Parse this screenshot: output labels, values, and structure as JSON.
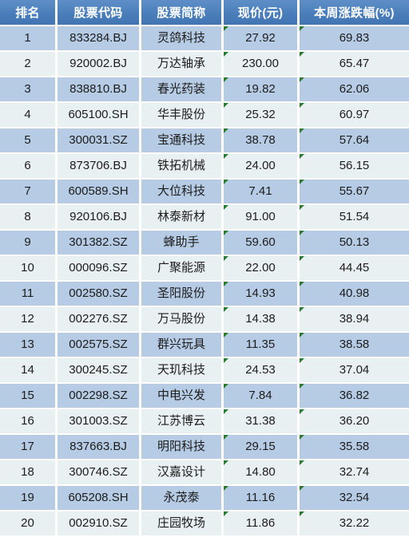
{
  "table": {
    "name": "stock-weekly-gainers-table",
    "columns": [
      {
        "key": "rank",
        "label": "排名",
        "marker": false
      },
      {
        "key": "code",
        "label": "股票代码",
        "marker": false
      },
      {
        "key": "name",
        "label": "股票简称",
        "marker": false
      },
      {
        "key": "price",
        "label": "现价(元)",
        "marker": true
      },
      {
        "key": "change",
        "label": "本周涨跌幅(%)",
        "marker": true
      }
    ],
    "marker_icon": "green-corner-triangle-icon",
    "marker_color": "#2d7a33",
    "header_color": "#4a7ebb",
    "row_odd_color": "#b6cbe4",
    "row_even_color": "#e9f0f2",
    "rows": [
      {
        "rank": "1",
        "code": "833284.BJ",
        "name": "灵鸽科技",
        "price": "27.92",
        "change": "69.83"
      },
      {
        "rank": "2",
        "code": "920002.BJ",
        "name": "万达轴承",
        "price": "230.00",
        "change": "65.47"
      },
      {
        "rank": "3",
        "code": "838810.BJ",
        "name": "春光药装",
        "price": "19.82",
        "change": "62.06"
      },
      {
        "rank": "4",
        "code": "605100.SH",
        "name": "华丰股份",
        "price": "25.32",
        "change": "60.97"
      },
      {
        "rank": "5",
        "code": "300031.SZ",
        "name": "宝通科技",
        "price": "38.78",
        "change": "57.64"
      },
      {
        "rank": "6",
        "code": "873706.BJ",
        "name": "铁拓机械",
        "price": "24.00",
        "change": "56.15"
      },
      {
        "rank": "7",
        "code": "600589.SH",
        "name": "大位科技",
        "price": "7.41",
        "change": "55.67"
      },
      {
        "rank": "8",
        "code": "920106.BJ",
        "name": "林泰新材",
        "price": "91.00",
        "change": "51.54"
      },
      {
        "rank": "9",
        "code": "301382.SZ",
        "name": "蜂助手",
        "price": "59.60",
        "change": "50.13"
      },
      {
        "rank": "10",
        "code": "000096.SZ",
        "name": "广聚能源",
        "price": "22.00",
        "change": "44.45"
      },
      {
        "rank": "11",
        "code": "002580.SZ",
        "name": "圣阳股份",
        "price": "14.93",
        "change": "40.98"
      },
      {
        "rank": "12",
        "code": "002276.SZ",
        "name": "万马股份",
        "price": "14.38",
        "change": "38.94"
      },
      {
        "rank": "13",
        "code": "002575.SZ",
        "name": "群兴玩具",
        "price": "11.35",
        "change": "38.58"
      },
      {
        "rank": "14",
        "code": "300245.SZ",
        "name": "天玑科技",
        "price": "24.53",
        "change": "37.04"
      },
      {
        "rank": "15",
        "code": "002298.SZ",
        "name": "中电兴发",
        "price": "7.84",
        "change": "36.82"
      },
      {
        "rank": "16",
        "code": "301003.SZ",
        "name": "江苏博云",
        "price": "31.38",
        "change": "36.20"
      },
      {
        "rank": "17",
        "code": "837663.BJ",
        "name": "明阳科技",
        "price": "29.15",
        "change": "35.58"
      },
      {
        "rank": "18",
        "code": "300746.SZ",
        "name": "汉嘉设计",
        "price": "14.80",
        "change": "32.74"
      },
      {
        "rank": "19",
        "code": "605208.SH",
        "name": "永茂泰",
        "price": "11.16",
        "change": "32.54"
      },
      {
        "rank": "20",
        "code": "002910.SZ",
        "name": "庄园牧场",
        "price": "11.86",
        "change": "32.22"
      }
    ]
  }
}
